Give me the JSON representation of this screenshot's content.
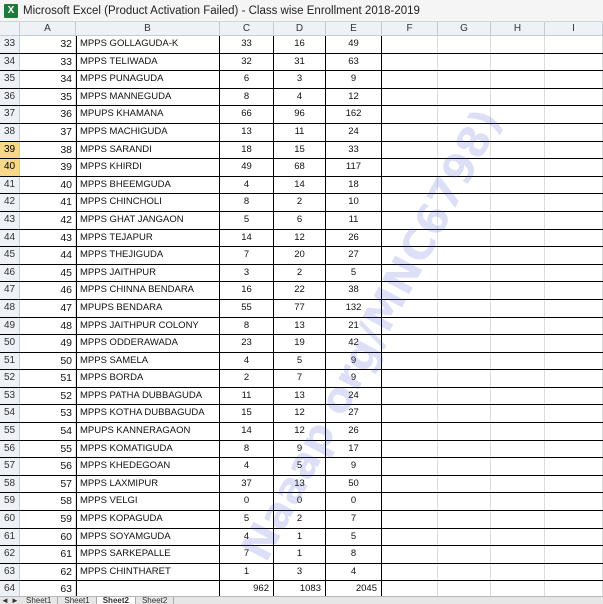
{
  "window": {
    "app_icon": "X",
    "title": "Microsoft Excel (Product Activation Failed) - Class wise Enrollment  2018-2019"
  },
  "columns": [
    "A",
    "B",
    "C",
    "D",
    "E",
    "F",
    "G",
    "H",
    "I"
  ],
  "selected_rows": [
    "39",
    "40"
  ],
  "rows": [
    {
      "r": "33",
      "a": "32",
      "b": "MPPS GOLLAGUDA-K",
      "c": "33",
      "d": "16",
      "e": "49"
    },
    {
      "r": "34",
      "a": "33",
      "b": "MPPS TELIWADA",
      "c": "32",
      "d": "31",
      "e": "63"
    },
    {
      "r": "35",
      "a": "34",
      "b": "MPPS PUNAGUDA",
      "c": "6",
      "d": "3",
      "e": "9"
    },
    {
      "r": "36",
      "a": "35",
      "b": "MPPS MANNEGUDA",
      "c": "8",
      "d": "4",
      "e": "12"
    },
    {
      "r": "37",
      "a": "36",
      "b": "MPUPS KHAMANA",
      "c": "66",
      "d": "96",
      "e": "162"
    },
    {
      "r": "38",
      "a": "37",
      "b": "MPPS MACHIGUDA",
      "c": "13",
      "d": "11",
      "e": "24"
    },
    {
      "r": "39",
      "a": "38",
      "b": "MPPS SARANDI",
      "c": "18",
      "d": "15",
      "e": "33"
    },
    {
      "r": "40",
      "a": "39",
      "b": "MPPS KHIRDI",
      "c": "49",
      "d": "68",
      "e": "117"
    },
    {
      "r": "41",
      "a": "40",
      "b": "MPPS BHEEMGUDA",
      "c": "4",
      "d": "14",
      "e": "18"
    },
    {
      "r": "42",
      "a": "41",
      "b": "MPPS CHINCHOLI",
      "c": "8",
      "d": "2",
      "e": "10"
    },
    {
      "r": "43",
      "a": "42",
      "b": "MPPS GHAT JANGAON",
      "c": "5",
      "d": "6",
      "e": "11"
    },
    {
      "r": "44",
      "a": "43",
      "b": "MPPS TEJAPUR",
      "c": "14",
      "d": "12",
      "e": "26"
    },
    {
      "r": "45",
      "a": "44",
      "b": "MPPS THEJIGUDA",
      "c": "7",
      "d": "20",
      "e": "27"
    },
    {
      "r": "46",
      "a": "45",
      "b": "MPPS JAITHPUR",
      "c": "3",
      "d": "2",
      "e": "5"
    },
    {
      "r": "47",
      "a": "46",
      "b": "MPPS CHINNA BENDARA",
      "c": "16",
      "d": "22",
      "e": "38"
    },
    {
      "r": "48",
      "a": "47",
      "b": "MPUPS BENDARA",
      "c": "55",
      "d": "77",
      "e": "132"
    },
    {
      "r": "49",
      "a": "48",
      "b": "MPPS JAITHPUR COLONY",
      "c": "8",
      "d": "13",
      "e": "21"
    },
    {
      "r": "50",
      "a": "49",
      "b": "MPPS ODDERAWADA",
      "c": "23",
      "d": "19",
      "e": "42"
    },
    {
      "r": "51",
      "a": "50",
      "b": "MPPS SAMELA",
      "c": "4",
      "d": "5",
      "e": "9"
    },
    {
      "r": "52",
      "a": "51",
      "b": "MPPS BORDA",
      "c": "2",
      "d": "7",
      "e": "9"
    },
    {
      "r": "53",
      "a": "52",
      "b": "MPPS PATHA DUBBAGUDA",
      "c": "11",
      "d": "13",
      "e": "24"
    },
    {
      "r": "54",
      "a": "53",
      "b": "MPPS KOTHA DUBBAGUDA",
      "c": "15",
      "d": "12",
      "e": "27"
    },
    {
      "r": "55",
      "a": "54",
      "b": "MPUPS KANNERAGAON",
      "c": "14",
      "d": "12",
      "e": "26"
    },
    {
      "r": "56",
      "a": "55",
      "b": "MPPS KOMATIGUDA",
      "c": "8",
      "d": "9",
      "e": "17"
    },
    {
      "r": "57",
      "a": "56",
      "b": "MPPS KHEDEGOAN",
      "c": "4",
      "d": "5",
      "e": "9"
    },
    {
      "r": "58",
      "a": "57",
      "b": "MPPS LAXMIPUR",
      "c": "37",
      "d": "13",
      "e": "50"
    },
    {
      "r": "59",
      "a": "58",
      "b": "MPPS VELGI",
      "c": "0",
      "d": "0",
      "e": "0"
    },
    {
      "r": "60",
      "a": "59",
      "b": "MPPS KOPAGUDA",
      "c": "5",
      "d": "2",
      "e": "7"
    },
    {
      "r": "61",
      "a": "60",
      "b": "MPPS SOYAMGUDA",
      "c": "4",
      "d": "1",
      "e": "5"
    },
    {
      "r": "62",
      "a": "61",
      "b": "MPPS SARKEPALLE",
      "c": "7",
      "d": "1",
      "e": "8"
    },
    {
      "r": "63",
      "a": "62",
      "b": "MPPS CHINTHARET",
      "c": "1",
      "d": "3",
      "e": "4"
    }
  ],
  "total_row": {
    "r": "64",
    "a": "63",
    "b": "",
    "c": "962",
    "d": "1083",
    "e": "2045"
  },
  "sheet_tabs": [
    "Sheet1",
    "Sheet1",
    "Sheet2",
    "Sheet2"
  ],
  "active_tab_index": 2,
  "watermark": "Naaap org/MNC6798)"
}
